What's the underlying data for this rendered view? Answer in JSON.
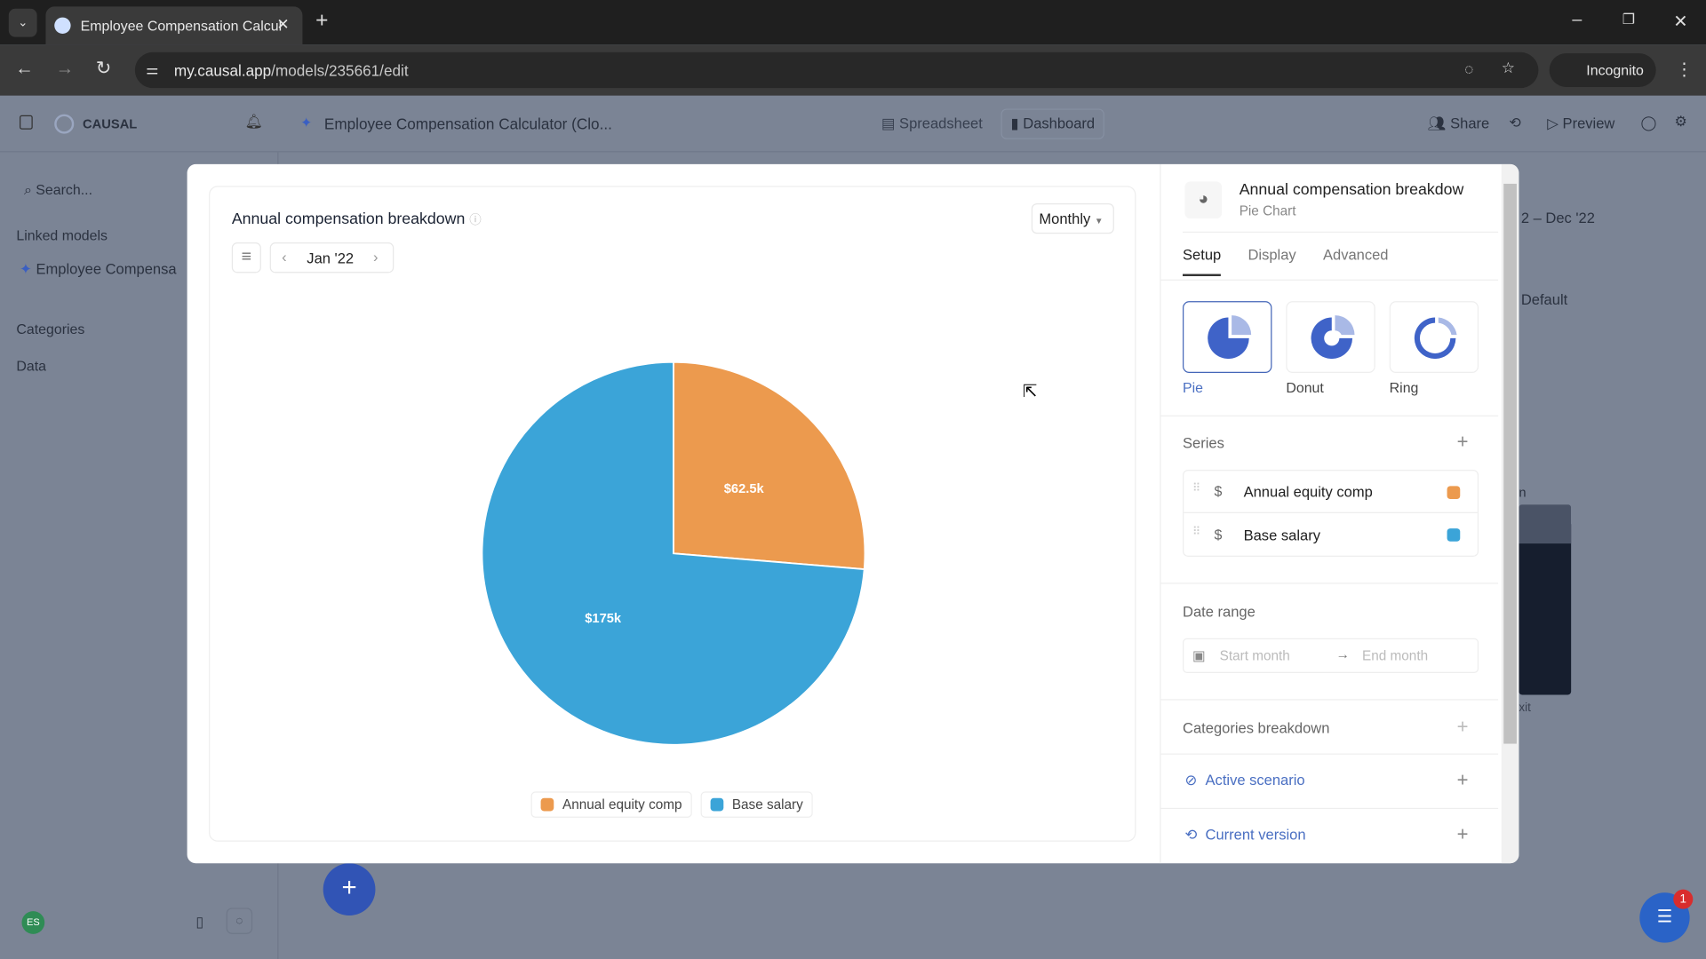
{
  "browser": {
    "tab_title": "Employee Compensation Calcul",
    "url_domain": "my.causal.app",
    "url_path": "/models/235661/edit",
    "incognito_label": "Incognito"
  },
  "app": {
    "brand": "CAUSAL",
    "model_title": "Employee Compensation Calculator (Clo...",
    "view_spreadsheet": "Spreadsheet",
    "view_dashboard": "Dashboard",
    "share": "Share",
    "preview": "Preview"
  },
  "sidebar": {
    "search_placeholder": "Search...",
    "linked_models": "Linked models",
    "linked_item": "Employee Compensa",
    "categories": "Categories",
    "data": "Data",
    "avatar": "ES"
  },
  "background": {
    "date_range": "2 – Dec '22",
    "default": "Default",
    "frag1": "n",
    "frag2": "xit"
  },
  "chart_card": {
    "title": "Annual compensation breakdown",
    "granularity": "Monthly",
    "period": "Jan '22"
  },
  "chart_data": {
    "type": "pie",
    "title": "Annual compensation breakdown",
    "categories": [
      "Annual equity comp",
      "Base salary"
    ],
    "values": [
      62.5,
      175
    ],
    "labels": [
      "$62.5k",
      "$175k"
    ],
    "unit": "$k",
    "colors": [
      "#ec9a4e",
      "#3ba4d8"
    ],
    "legend": "bottom"
  },
  "panel": {
    "title": "Annual compensation breakdow",
    "subtitle": "Pie Chart",
    "tabs": [
      "Setup",
      "Display",
      "Advanced"
    ],
    "active_tab": "Setup",
    "types": [
      {
        "label": "Pie",
        "selected": true
      },
      {
        "label": "Donut",
        "selected": false
      },
      {
        "label": "Ring",
        "selected": false
      }
    ],
    "series_label": "Series",
    "series": [
      {
        "name": "Annual equity comp",
        "color": "#ec9a4e"
      },
      {
        "name": "Base salary",
        "color": "#3ba4d8"
      }
    ],
    "date_range_label": "Date range",
    "start_placeholder": "Start month",
    "end_placeholder": "End month",
    "categories_breakdown": "Categories breakdown",
    "active_scenario": "Active scenario",
    "current_version": "Current version"
  },
  "chat_badge": "1"
}
